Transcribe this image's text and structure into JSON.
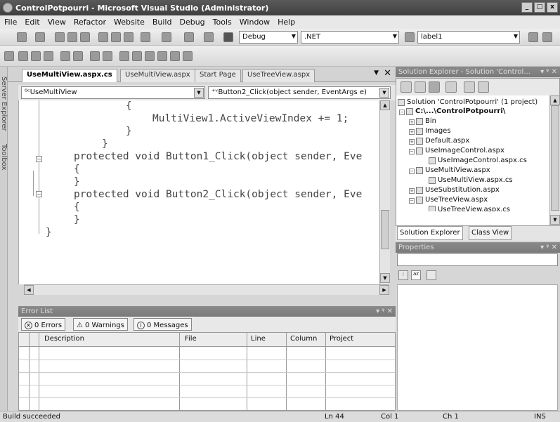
{
  "window": {
    "title": "ControlPotpourri - Microsoft Visual Studio (Administrator)"
  },
  "menu": [
    "File",
    "Edit",
    "View",
    "Refactor",
    "Website",
    "Build",
    "Debug",
    "Tools",
    "Window",
    "Help"
  ],
  "toolbar": {
    "config": "Debug",
    "platform": ".NET",
    "find": "label1"
  },
  "left_strip": {
    "server_explorer": "Server Explorer",
    "toolbox": "Toolbox"
  },
  "tabs": [
    "UseMultiView.aspx.cs",
    "UseMultiView.aspx",
    "Start Page",
    "UseTreeView.aspx"
  ],
  "editor": {
    "class_combo": "UseMultiView",
    "member_combo": "Button2_Click(object sender, EventArgs e)",
    "code": [
      "{",
      "MultiView1.ActiveViewIndex += 1;",
      "}",
      "}",
      "protected void Button1_Click(object sender, Eve",
      "{",
      "}",
      "protected void Button2_Click(object sender, Eve",
      "{",
      "}",
      "}"
    ]
  },
  "error_list": {
    "title": "Error List",
    "errors": "0 Errors",
    "warnings": "0 Warnings",
    "messages": "0 Messages",
    "columns": [
      "Description",
      "File",
      "Line",
      "Column",
      "Project"
    ]
  },
  "solution_explorer": {
    "title": "Solution Explorer - Solution 'Control...",
    "items": [
      "Solution 'ControlPotpourri' (1 project)",
      "C:\\...\\ControlPotpourri\\",
      "Bin",
      "Images",
      "Default.aspx",
      "UseImageControl.aspx",
      "UseImageControl.aspx.cs",
      "UseMultiView.aspx",
      "UseMultiView.aspx.cs",
      "UseSubstitution.aspx",
      "UseTreeView.aspx",
      "UseTreeView.aspx.cs"
    ],
    "tab_solution": "Solution Explorer",
    "tab_class": "Class View"
  },
  "properties": {
    "title": "Properties"
  },
  "status": {
    "message": "Build succeeded",
    "ln": "Ln 44",
    "col": "Col 1",
    "ch": "Ch 1",
    "mode": "INS"
  }
}
